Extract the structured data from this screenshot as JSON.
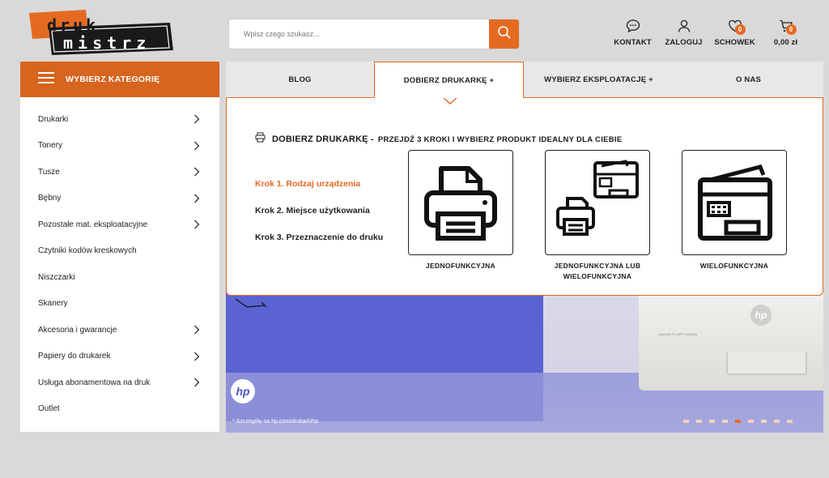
{
  "header": {
    "logo_line1": "druk",
    "logo_line2": "mistrz",
    "search_placeholder": "Wpisz czego szukasz...",
    "icons": [
      {
        "name": "kontakt",
        "label": "KONTAKT",
        "icon": "chat-icon"
      },
      {
        "name": "zaloguj",
        "label": "ZALOGUJ",
        "icon": "user-icon"
      },
      {
        "name": "schowek",
        "label": "SCHOWEK",
        "icon": "heart-icon",
        "badge": "0"
      },
      {
        "name": "cart",
        "label": "0,00 zł",
        "icon": "cart-icon",
        "badge": "0"
      }
    ]
  },
  "categories": {
    "title": "WYBIERZ KATEGORIĘ",
    "items": [
      {
        "label": "Drukarki",
        "has_sub": true
      },
      {
        "label": "Tonery",
        "has_sub": true
      },
      {
        "label": "Tusze",
        "has_sub": true
      },
      {
        "label": "Bębny",
        "has_sub": true
      },
      {
        "label": "Pozostałe mat. eksploatacyjne",
        "has_sub": true
      },
      {
        "label": "Czytniki kodów kreskowych",
        "has_sub": false
      },
      {
        "label": "Niszczarki",
        "has_sub": false
      },
      {
        "label": "Skanery",
        "has_sub": false
      },
      {
        "label": "Akcesoria i gwarancje",
        "has_sub": true
      },
      {
        "label": "Papiery do drukarek",
        "has_sub": true
      },
      {
        "label": "Usługa abonamentowa na druk",
        "has_sub": true
      },
      {
        "label": "Outlet",
        "has_sub": false
      }
    ]
  },
  "nav": {
    "items": [
      "BLOG",
      "DOBIERZ DRUKARKĘ +",
      "WYBIERZ EKSPLOATACJĘ +",
      "O NAS"
    ],
    "active_index": 1
  },
  "dropdown": {
    "title": "DOBIERZ DRUKARKĘ -",
    "subtitle": "PRZEJDŹ 3 KROKI I WYBIERZ PRODUKT IDEALNY DLA CIEBIE",
    "steps": [
      "Krok 1. Rodzaj urządzenia",
      "Krok 2. Miejsce użytkowania",
      "Krok 3. Przeznaczenie do druku"
    ],
    "active_step": 0,
    "options": [
      {
        "line1": "JEDNOFUNKCYJNA",
        "line2": "",
        "icon": "single-function-printer-icon"
      },
      {
        "line1": "JEDNOFUNKCYJNA LUB",
        "line2": "WIELOFUNKCYJNA",
        "icon": "single-or-multifunction-printer-icon"
      },
      {
        "line1": "WIELOFUNKCYJNA",
        "line2": "",
        "icon": "multifunction-printer-icon"
      }
    ]
  },
  "banner": {
    "brand": "hp",
    "disclaimer": "* Szczegóły na hp.com/drukarkihp.",
    "slides": 9,
    "active_slide": 4
  },
  "colors": {
    "accent": "#e46a22",
    "category_header": "#d7641f",
    "banner_blue": "#5a63d1"
  }
}
